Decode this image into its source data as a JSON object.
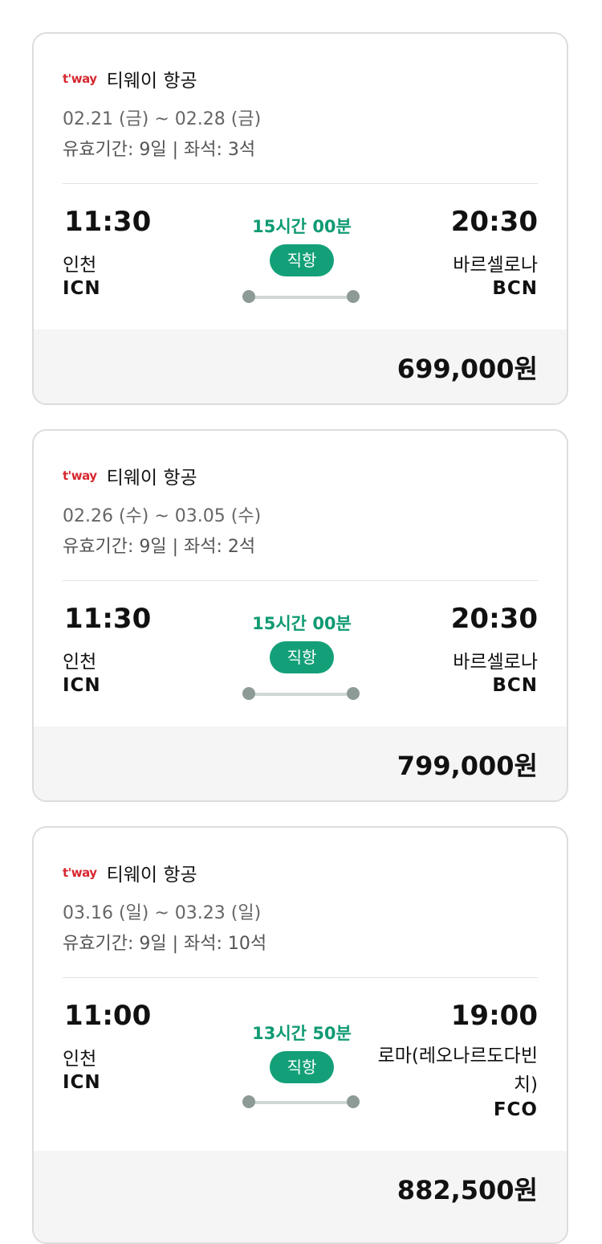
{
  "colors": {
    "accent": "#13a079",
    "logo": "#d7282f",
    "price_bg": "#f5f5f5"
  },
  "flights": [
    {
      "airline_logo": "t'way",
      "airline_name": "티웨이 항공",
      "dates": "02.21 (금) ~ 02.28 (금)",
      "meta": "유효기간: 9일 | 좌석: 3석",
      "departure": {
        "time": "11:30",
        "city": "인천",
        "code": "ICN"
      },
      "arrival": {
        "time": "20:30",
        "city": "바르셀로나",
        "code": "BCN"
      },
      "duration": "15시간 00분",
      "type": "직항",
      "price": "699,000원"
    },
    {
      "airline_logo": "t'way",
      "airline_name": "티웨이 항공",
      "dates": "02.26 (수) ~ 03.05 (수)",
      "meta": "유효기간: 9일 | 좌석: 2석",
      "departure": {
        "time": "11:30",
        "city": "인천",
        "code": "ICN"
      },
      "arrival": {
        "time": "20:30",
        "city": "바르셀로나",
        "code": "BCN"
      },
      "duration": "15시간 00분",
      "type": "직항",
      "price": "799,000원"
    },
    {
      "airline_logo": "t'way",
      "airline_name": "티웨이 항공",
      "dates": "03.16 (일) ~ 03.23 (일)",
      "meta": "유효기간: 9일 | 좌석: 10석",
      "departure": {
        "time": "11:00",
        "city": "인천",
        "code": "ICN"
      },
      "arrival": {
        "time": "19:00",
        "city": "로마(레오나르도다빈치)",
        "code": "FCO"
      },
      "duration": "13시간 50분",
      "type": "직항",
      "price": "882,500원"
    }
  ]
}
